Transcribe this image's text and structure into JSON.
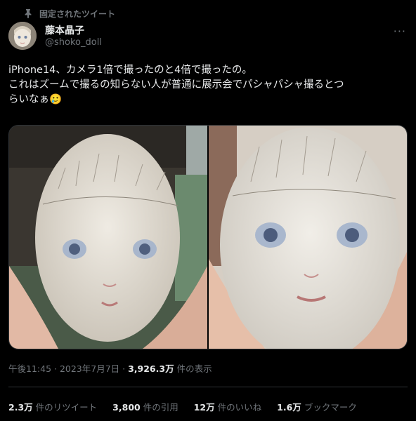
{
  "pinned_label": "固定されたツイート",
  "author": {
    "name": "藤本晶子",
    "handle": "@shoko_doll"
  },
  "tweet": {
    "lines": [
      "iPhone14、カメラ1倍で撮ったのと4倍で撮ったの。",
      "これはズームで撮るの知らない人が普通に展示会でパシャパシャ撮るとつ",
      "らいなぁ🥲"
    ]
  },
  "meta": {
    "time": "午後11:45",
    "sep1": " · ",
    "date": "2023年7月7日",
    "sep2": " · ",
    "views": "3,926.3万",
    "views_label": " 件の表示"
  },
  "stats": {
    "retweets": "2.3万",
    "retweets_label": "件のリツイート",
    "quotes": "3,800",
    "quotes_label": "件の引用",
    "likes": "12万",
    "likes_label": "件のいいね",
    "bookmarks": "1.6万",
    "bookmarks_label": "ブックマーク"
  },
  "icons": [
    "pin-icon",
    "more-icon"
  ]
}
